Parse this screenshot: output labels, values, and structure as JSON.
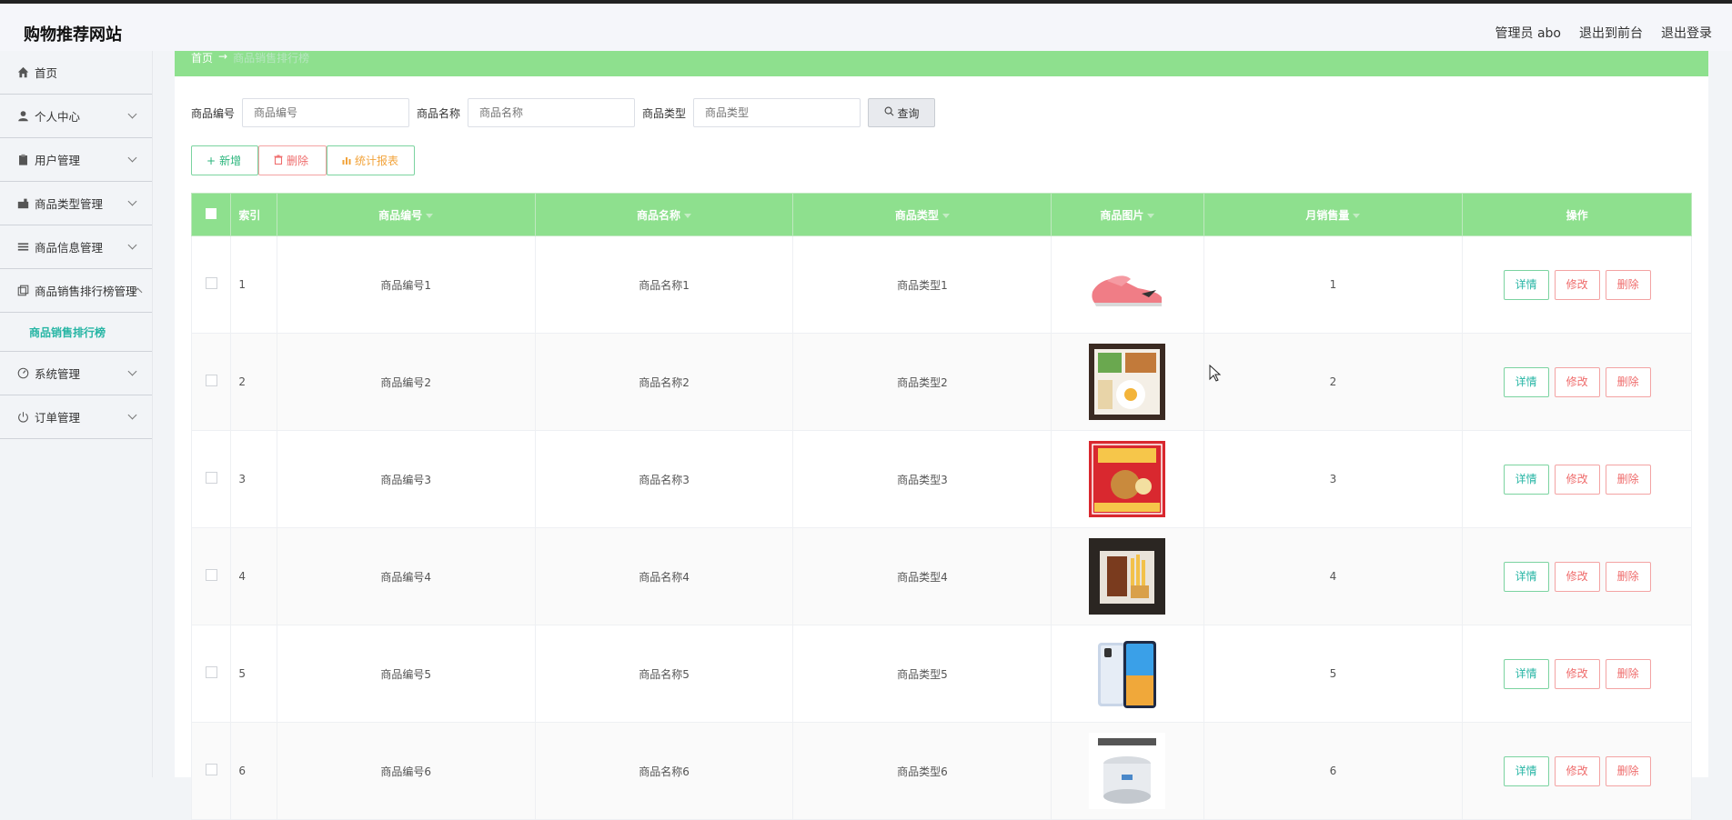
{
  "header": {
    "title": "购物推荐网站",
    "user": "管理员 abo",
    "to_front": "退出到前台",
    "logout": "退出登录"
  },
  "sidebar": {
    "items": [
      {
        "label": "首页",
        "icon": "home-icon"
      },
      {
        "label": "个人中心",
        "icon": "user-icon"
      },
      {
        "label": "用户管理",
        "icon": "clipboard-icon"
      },
      {
        "label": "商品类型管理",
        "icon": "category-icon"
      },
      {
        "label": "商品信息管理",
        "icon": "list-icon"
      },
      {
        "label": "商品销售排行榜管理",
        "icon": "copy-icon"
      },
      {
        "label": "系统管理",
        "icon": "gauge-icon"
      },
      {
        "label": "订单管理",
        "icon": "power-icon"
      }
    ],
    "sub_active": "商品销售排行榜"
  },
  "breadcrumb": {
    "home": "首页",
    "arrow": "→",
    "current": "商品销售排行榜"
  },
  "search": {
    "code_label": "商品编号",
    "code_placeholder": "商品编号",
    "name_label": "商品名称",
    "name_placeholder": "商品名称",
    "type_label": "商品类型",
    "type_placeholder": "商品类型",
    "button": "查询"
  },
  "actions": {
    "add": "新增",
    "delete": "删除",
    "report": "统计报表"
  },
  "table": {
    "headers": {
      "index": "索引",
      "code": "商品编号",
      "name": "商品名称",
      "type": "商品类型",
      "image": "商品图片",
      "sales": "月销售量",
      "ops": "操作"
    },
    "ops": {
      "detail": "详情",
      "edit": "修改",
      "delete": "删除"
    },
    "rows": [
      {
        "index": "1",
        "code": "商品编号1",
        "name": "商品名称1",
        "type": "商品类型1",
        "image": "pink sneaker",
        "sales": "1"
      },
      {
        "index": "2",
        "code": "商品编号2",
        "name": "商品名称2",
        "type": "商品类型2",
        "image": "bento box",
        "sales": "2"
      },
      {
        "index": "3",
        "code": "商品编号3",
        "name": "商品名称3",
        "type": "商品类型3",
        "image": "snack box",
        "sales": "3"
      },
      {
        "index": "4",
        "code": "商品编号4",
        "name": "商品名称4",
        "type": "商品类型4",
        "image": "fries meal",
        "sales": "4"
      },
      {
        "index": "5",
        "code": "商品编号5",
        "name": "商品名称5",
        "type": "商品类型5",
        "image": "smartphone",
        "sales": "5"
      },
      {
        "index": "6",
        "code": "商品编号6",
        "name": "商品名称6",
        "type": "商品类型6",
        "image": "rice cooker",
        "sales": "6"
      }
    ]
  },
  "colors": {
    "accent": "#8ee08e",
    "teal": "#26b5a4",
    "danger": "#ef6c6c",
    "orange": "#f2a33a"
  }
}
